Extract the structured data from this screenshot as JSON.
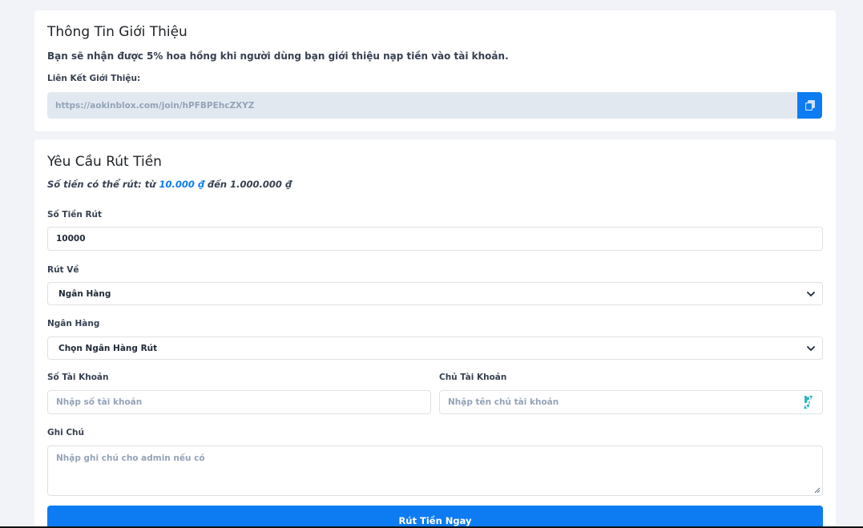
{
  "referral": {
    "title": "Thông Tin Giới Thiệu",
    "description": "Bạn sẽ nhận được 5% hoa hồng khi người dùng bạn giới thiệu nạp tiền vào tài khoản.",
    "link_label": "Liên Kết Giới Thiệu:",
    "link_value": "https://aokinblox.com/join/hPFBPEhcZXYZ",
    "copy_icon": "copy-icon"
  },
  "withdraw": {
    "title": "Yêu Cầu Rút Tiền",
    "range_prefix": "Số tiền có thể rút: từ ",
    "range_min": "10.000 ₫",
    "range_mid": " đến ",
    "range_max": "1.000.000 ₫",
    "amount_label": "Số Tiền Rút",
    "amount_value": "10000",
    "method_label": "Rút Về",
    "method_selected": "Ngân Hàng",
    "bank_label": "Ngân Hàng",
    "bank_selected": "Chọn Ngân Hàng Rút",
    "account_number_label": "Số Tài Khoản",
    "account_number_placeholder": "Nhập số tài khoản",
    "account_owner_label": "Chủ Tài Khoản",
    "account_owner_placeholder": "Nhập tên chủ tài khoản",
    "note_label": "Ghi Chú",
    "note_placeholder": "Nhập ghi chú cho admin nếu có",
    "submit_label": "Rút Tiền Ngay"
  },
  "colors": {
    "accent": "#0d7cf2",
    "page_bg": "#f1f3f8",
    "input_disabled_bg": "#e2e8f0"
  }
}
